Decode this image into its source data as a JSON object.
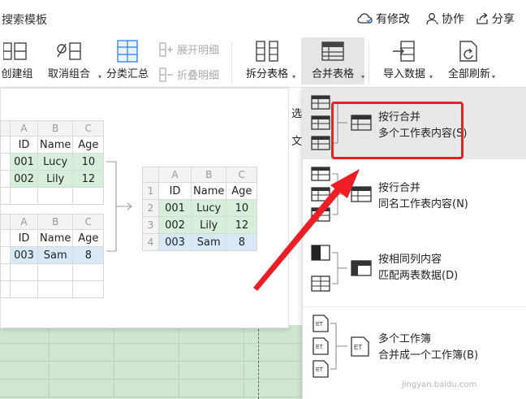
{
  "titlebar": {
    "search_template": "搜索模板",
    "modified": "有修改",
    "collab": "协作",
    "share": "分享"
  },
  "ribbon": {
    "create_group": "创建组",
    "ungroup": "取消组合",
    "subtotal": "分类汇总",
    "expand_detail": "展开明细",
    "collapse_detail": "折叠明细",
    "split_table": "拆分表格",
    "merge_table": "合并表格",
    "import_data": "导入数据",
    "refresh_all": "全部刷新"
  },
  "preview": {
    "col_headers": [
      "A",
      "B",
      "C"
    ],
    "table1": {
      "header": [
        "ID",
        "Name",
        "Age"
      ],
      "rows": [
        [
          "001",
          "Lucy",
          "10"
        ],
        [
          "002",
          "Lily",
          "12"
        ]
      ]
    },
    "table2": {
      "header": [
        "ID",
        "Name",
        "Age"
      ],
      "rows": [
        [
          "003",
          "Sam",
          "8"
        ]
      ]
    },
    "result": {
      "row_numbers": [
        "1",
        "2",
        "3",
        "4"
      ],
      "header": [
        "ID",
        "Name",
        "Age"
      ],
      "rows": [
        [
          "001",
          "Lucy",
          "10"
        ],
        [
          "002",
          "Lily",
          "12"
        ],
        [
          "003",
          "Sam",
          "8"
        ]
      ]
    }
  },
  "side": {
    "c1": "选",
    "c2": "文"
  },
  "dropdown": {
    "items": [
      {
        "line1": "按行合并",
        "line2": "多个工作表内容(S)"
      },
      {
        "line1": "按行合并",
        "line2": "同名工作表内容(N)"
      },
      {
        "line1": "按相同列内容",
        "line2": "匹配两表数据(D)"
      },
      {
        "line1": "多个工作簿",
        "line2": "合并成一个工作簿(B)"
      }
    ]
  },
  "watermark": "jingyan.baidu.com",
  "colors": {
    "highlight_box": "#ee1f24",
    "green_row": "#d7eedb",
    "blue_row": "#d8e8f7"
  }
}
